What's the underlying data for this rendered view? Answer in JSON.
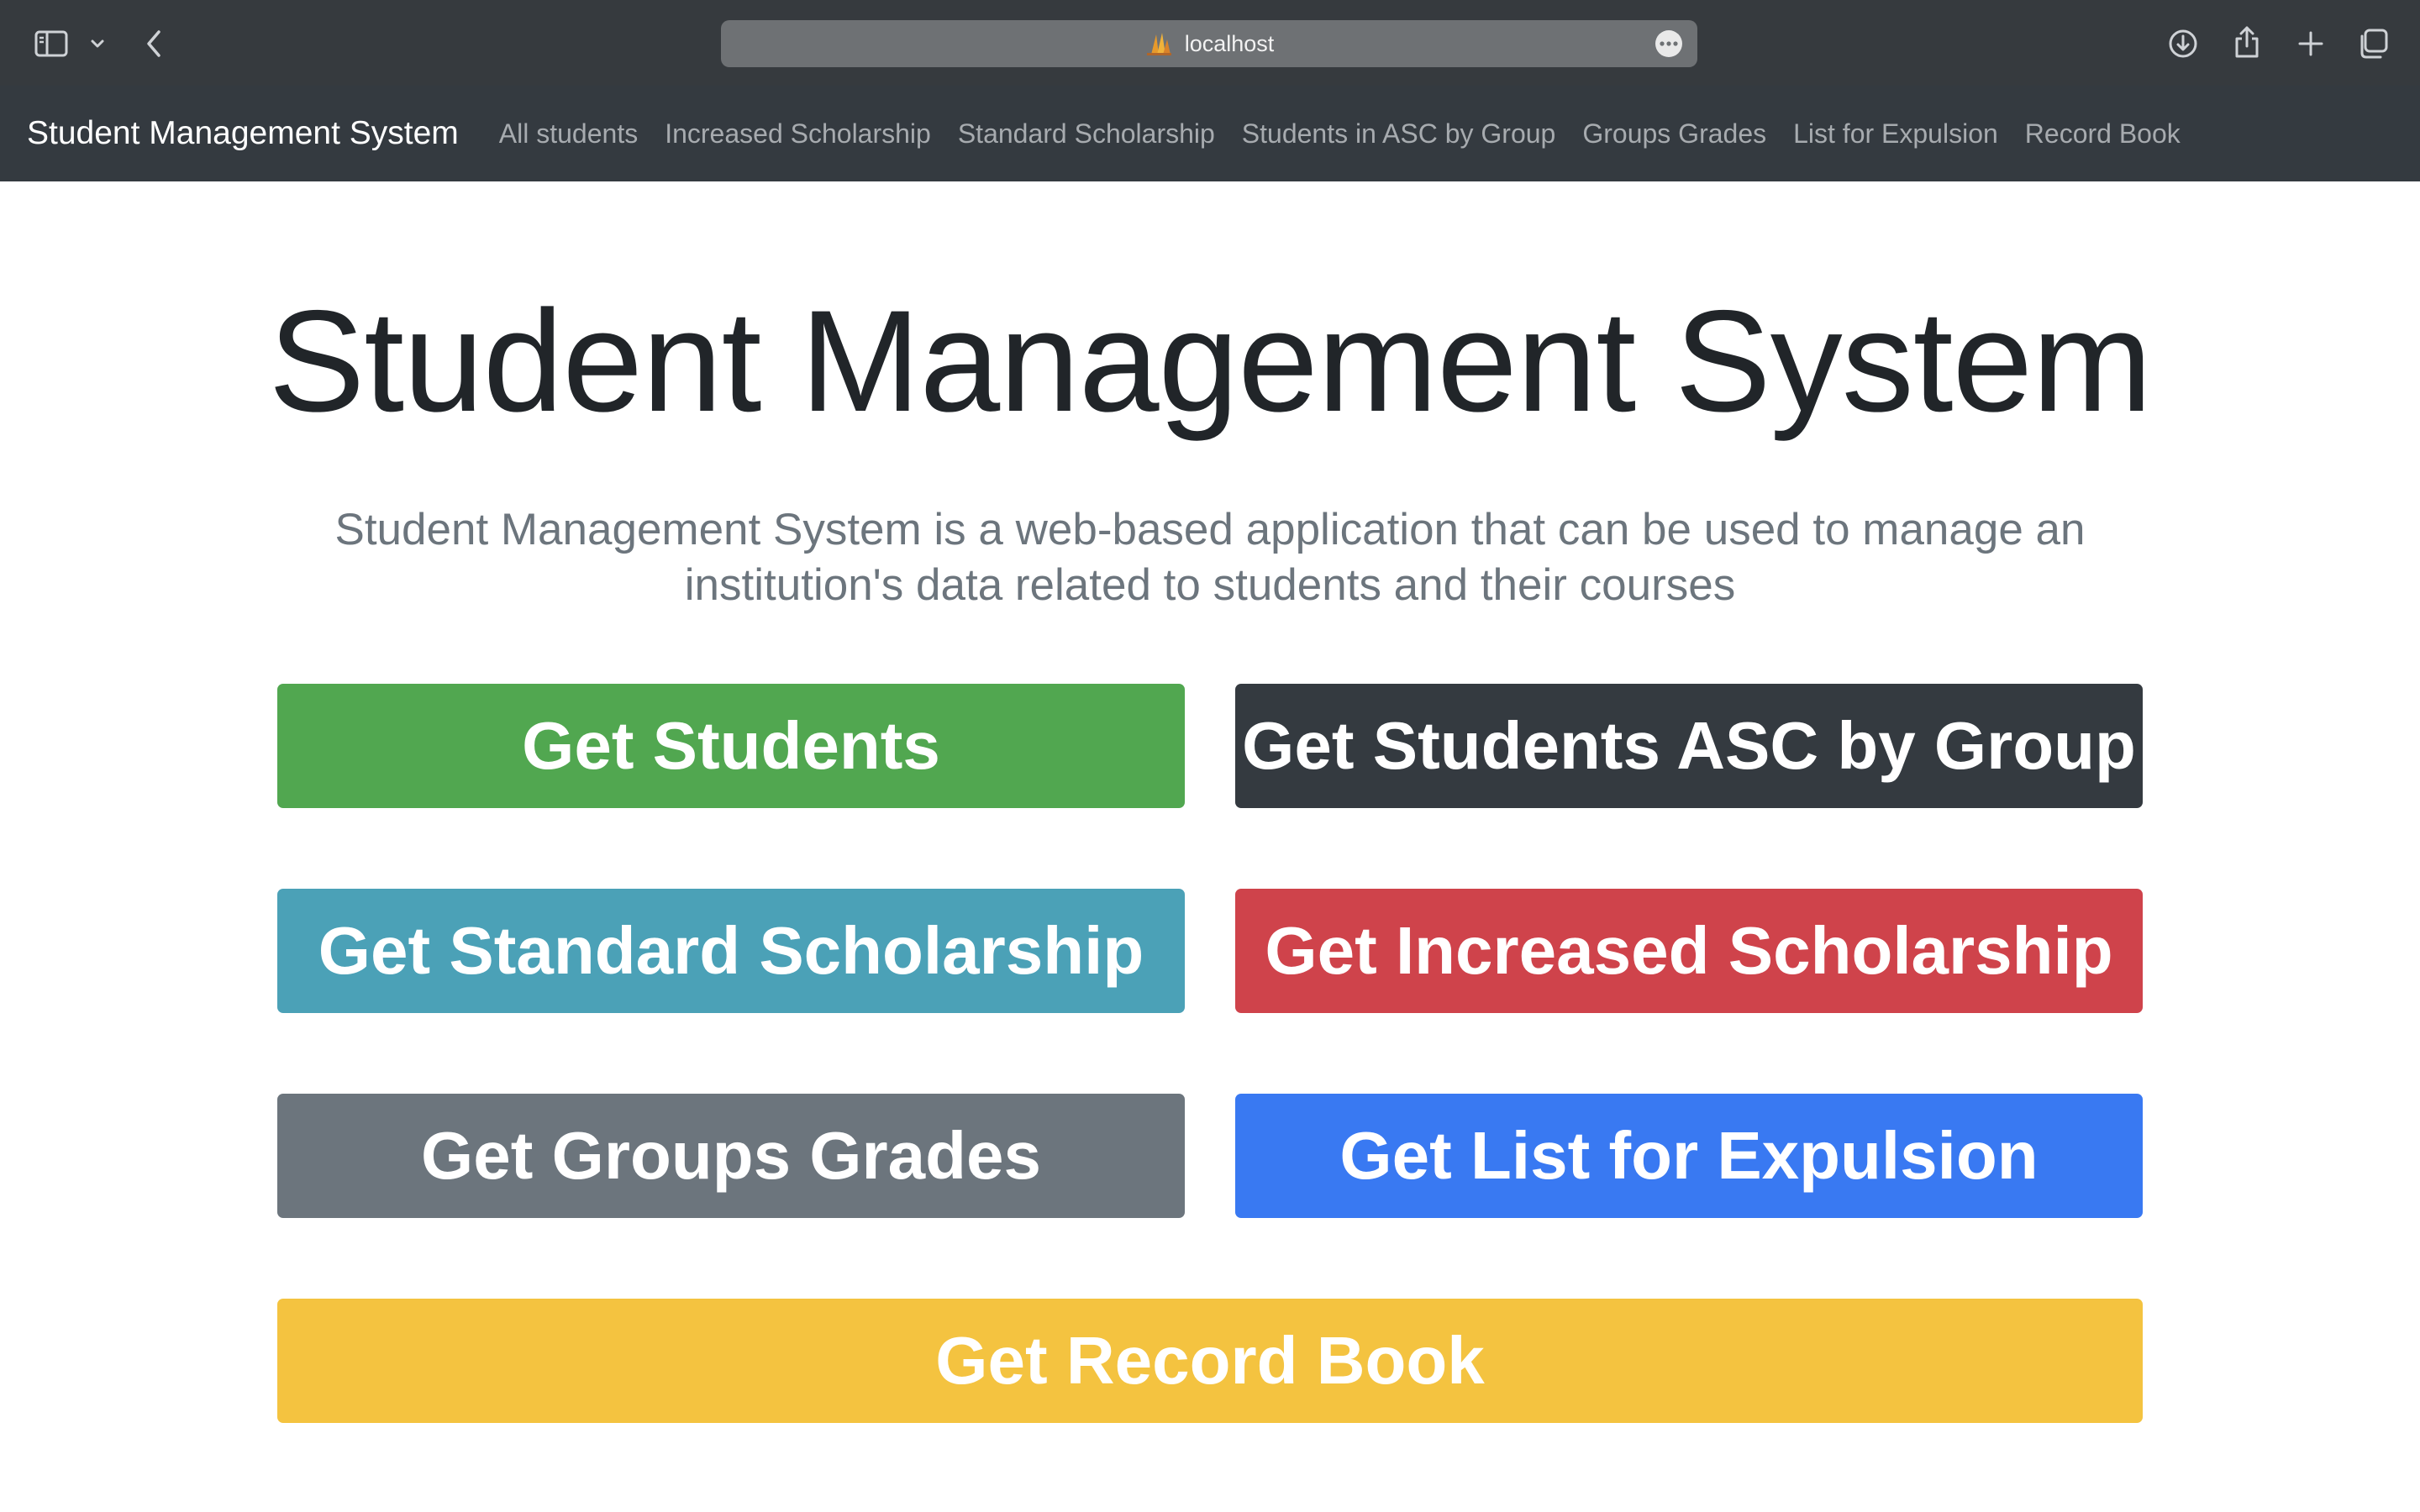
{
  "browser": {
    "address": "localhost"
  },
  "navbar": {
    "brand": "Student Management System",
    "links": [
      "All students",
      "Increased Scholarship",
      "Standard Scholarship",
      "Students in ASC by Group",
      "Groups Grades",
      "List for Expulsion",
      "Record Book"
    ]
  },
  "main": {
    "title": "Student Management System",
    "lead_line1": "Student Management System is a web-based application that can be used to manage an",
    "lead_line2": "institution's data related to students and their courses",
    "buttons": {
      "get_students": "Get Students",
      "get_students_asc": "Get Students ASC by Group",
      "get_standard_scholarship": "Get Standard Scholarship",
      "get_increased_scholarship": "Get Increased Scholarship",
      "get_groups_grades": "Get Groups Grades",
      "get_list_expulsion": "Get List for Expulsion",
      "get_record_book": "Get Record Book"
    }
  },
  "colors": {
    "success": "#51a750",
    "dark": "#343a40",
    "info": "#4ba1b7",
    "danger": "#cf434b",
    "secondary": "#6c757d",
    "primary": "#3979f2",
    "warning": "#f4c340"
  },
  "icons": {
    "sidebar": "sidebar-icon",
    "chevron": "chevron-down-icon",
    "back": "back-arrow-icon",
    "download": "download-icon",
    "share": "share-icon",
    "new_tab": "plus-icon",
    "tabs": "tabs-overview-icon",
    "more": "ellipsis-icon"
  }
}
